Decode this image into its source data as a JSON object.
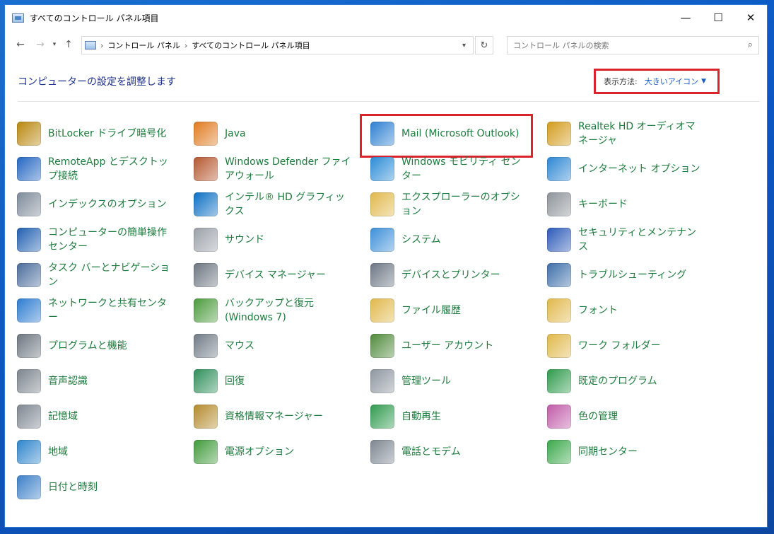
{
  "window": {
    "title": "すべてのコントロール パネル項目",
    "controls": {
      "minimize": "—",
      "maximize": "☐",
      "close": "✕"
    }
  },
  "addressbar": {
    "crumbs": [
      "コントロール パネル",
      "すべてのコントロール パネル項目"
    ],
    "search_placeholder": "コントロール パネルの検索"
  },
  "header": {
    "title": "コンピューターの設定を調整します",
    "viewby_label": "表示方法:",
    "viewby_value": "大きいアイコン"
  },
  "items": [
    {
      "label": "BitLocker ドライブ暗号化",
      "icon": "bitlocker-icon",
      "color": "#b8860b"
    },
    {
      "label": "Java",
      "icon": "java-icon",
      "color": "#e07a1f"
    },
    {
      "label": "Mail (Microsoft Outlook)",
      "icon": "mail-icon",
      "color": "#2c7fd1"
    },
    {
      "label": "Realtek HD オーディオマネージャ",
      "icon": "realtek-audio-icon",
      "color": "#d39b1b"
    },
    {
      "label": "RemoteApp とデスクトップ接続",
      "icon": "remoteapp-icon",
      "color": "#2366c2"
    },
    {
      "label": "Windows Defender ファイアウォール",
      "icon": "firewall-icon",
      "color": "#b5562e"
    },
    {
      "label": "Windows モビリティ センター",
      "icon": "mobility-center-icon",
      "color": "#2a8bd6"
    },
    {
      "label": "インターネット オプション",
      "icon": "internet-options-icon",
      "color": "#2c86d3"
    },
    {
      "label": "インデックスのオプション",
      "icon": "indexing-options-icon",
      "color": "#7d8a99"
    },
    {
      "label": "インテル® HD グラフィックス",
      "icon": "intel-graphics-icon",
      "color": "#0a6fc3"
    },
    {
      "label": "エクスプローラーのオプション",
      "icon": "explorer-options-icon",
      "color": "#e0b84a"
    },
    {
      "label": "キーボード",
      "icon": "keyboard-icon",
      "color": "#8d939a"
    },
    {
      "label": "コンピューターの簡単操作センター",
      "icon": "ease-of-access-icon",
      "color": "#1f5fb0"
    },
    {
      "label": "サウンド",
      "icon": "sound-icon",
      "color": "#9aa0a8"
    },
    {
      "label": "システム",
      "icon": "system-icon",
      "color": "#3b8ed8"
    },
    {
      "label": "セキュリティとメンテナンス",
      "icon": "security-maintenance-icon",
      "color": "#2b59b8"
    },
    {
      "label": "タスク バーとナビゲーション",
      "icon": "taskbar-icon",
      "color": "#4a6c9b"
    },
    {
      "label": "デバイス マネージャー",
      "icon": "device-manager-icon",
      "color": "#6c7580"
    },
    {
      "label": "デバイスとプリンター",
      "icon": "devices-printers-icon",
      "color": "#6b7683"
    },
    {
      "label": "トラブルシューティング",
      "icon": "troubleshooting-icon",
      "color": "#3c6ea9"
    },
    {
      "label": "ネットワークと共有センター",
      "icon": "network-sharing-icon",
      "color": "#2b7bd0"
    },
    {
      "label": "バックアップと復元 (Windows 7)",
      "icon": "backup-restore-icon",
      "color": "#4b9a3c"
    },
    {
      "label": "ファイル履歴",
      "icon": "file-history-icon",
      "color": "#e0b84a"
    },
    {
      "label": "フォント",
      "icon": "fonts-icon",
      "color": "#e0b84a"
    },
    {
      "label": "プログラムと機能",
      "icon": "programs-features-icon",
      "color": "#6c7580"
    },
    {
      "label": "マウス",
      "icon": "mouse-icon",
      "color": "#6f7a86"
    },
    {
      "label": "ユーザー アカウント",
      "icon": "user-accounts-icon",
      "color": "#4f8a3b"
    },
    {
      "label": "ワーク フォルダー",
      "icon": "work-folders-icon",
      "color": "#e0b84a"
    },
    {
      "label": "音声認識",
      "icon": "speech-recognition-icon",
      "color": "#7b838c"
    },
    {
      "label": "回復",
      "icon": "recovery-icon",
      "color": "#2e8f5a"
    },
    {
      "label": "管理ツール",
      "icon": "admin-tools-icon",
      "color": "#8d959f"
    },
    {
      "label": "既定のプログラム",
      "icon": "default-programs-icon",
      "color": "#2d9a4b"
    },
    {
      "label": "記憶域",
      "icon": "storage-spaces-icon",
      "color": "#7d8691"
    },
    {
      "label": "資格情報マネージャー",
      "icon": "credential-manager-icon",
      "color": "#b48a2c"
    },
    {
      "label": "自動再生",
      "icon": "autoplay-icon",
      "color": "#2f9a4e"
    },
    {
      "label": "色の管理",
      "icon": "color-management-icon",
      "color": "#c05aa8"
    },
    {
      "label": "地域",
      "icon": "region-icon",
      "color": "#2d84cc"
    },
    {
      "label": "電源オプション",
      "icon": "power-options-icon",
      "color": "#3f9a3a"
    },
    {
      "label": "電話とモデム",
      "icon": "phone-modem-icon",
      "color": "#7d8691"
    },
    {
      "label": "同期センター",
      "icon": "sync-center-icon",
      "color": "#3aa84a"
    },
    {
      "label": "日付と時刻",
      "icon": "date-time-icon",
      "color": "#3b7fc8"
    }
  ]
}
